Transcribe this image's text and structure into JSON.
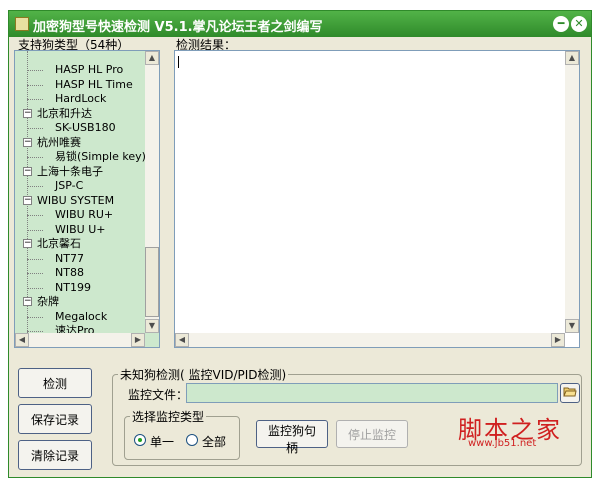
{
  "window": {
    "title": "加密狗型号快速检测 V5.1.掌凡论坛王者之剑编写",
    "minimize_glyph": "━",
    "close_glyph": "✕"
  },
  "labels": {
    "tree_header": "支持狗类型（54种）",
    "result_header": "检测结果："
  },
  "tree": {
    "items": [
      {
        "label": "HASP HL Pro",
        "level": 1
      },
      {
        "label": "HASP HL Time",
        "level": 1
      },
      {
        "label": "HardLock",
        "level": 1
      },
      {
        "label": "北京和升达",
        "level": 0,
        "expanded": true
      },
      {
        "label": "SK-USB180",
        "level": 1
      },
      {
        "label": "杭州唯赛",
        "level": 0,
        "expanded": true
      },
      {
        "label": "易锁(Simple key)",
        "level": 1
      },
      {
        "label": "上海十条电子",
        "level": 0,
        "expanded": true
      },
      {
        "label": "JSP-C",
        "level": 1
      },
      {
        "label": "WIBU SYSTEM",
        "level": 0,
        "expanded": true
      },
      {
        "label": "WIBU RU+",
        "level": 1
      },
      {
        "label": "WIBU U+",
        "level": 1
      },
      {
        "label": "北京馨石",
        "level": 0,
        "expanded": true
      },
      {
        "label": "NT77",
        "level": 1
      },
      {
        "label": "NT88",
        "level": 1
      },
      {
        "label": "NT199",
        "level": 1
      },
      {
        "label": "杂牌",
        "level": 0,
        "expanded": true
      },
      {
        "label": "Megalock",
        "level": 1
      },
      {
        "label": "速达Pro",
        "level": 1
      }
    ]
  },
  "buttons": {
    "detect": "检测",
    "save_log": "保存记录",
    "clear_log": "清除记录",
    "monitor_handle": "监控狗句柄",
    "stop_monitor": "停止监控"
  },
  "unknown_group": {
    "title": "未知狗检测( 监控VID/PID检测)",
    "file_label": "监控文件：",
    "file_value": "",
    "browse_icon": "folder-open-icon"
  },
  "monitor_type": {
    "title": "选择监控类型",
    "options": [
      "单一",
      "全部"
    ],
    "selected": "单一"
  },
  "watermark": {
    "main": "脚本之家",
    "sub": "www.jb51.net"
  },
  "colors": {
    "title_bar": "#2f8a2a",
    "panel": "#cde8cd",
    "window_bg": "#ece9d8",
    "watermark": "#d02020"
  }
}
